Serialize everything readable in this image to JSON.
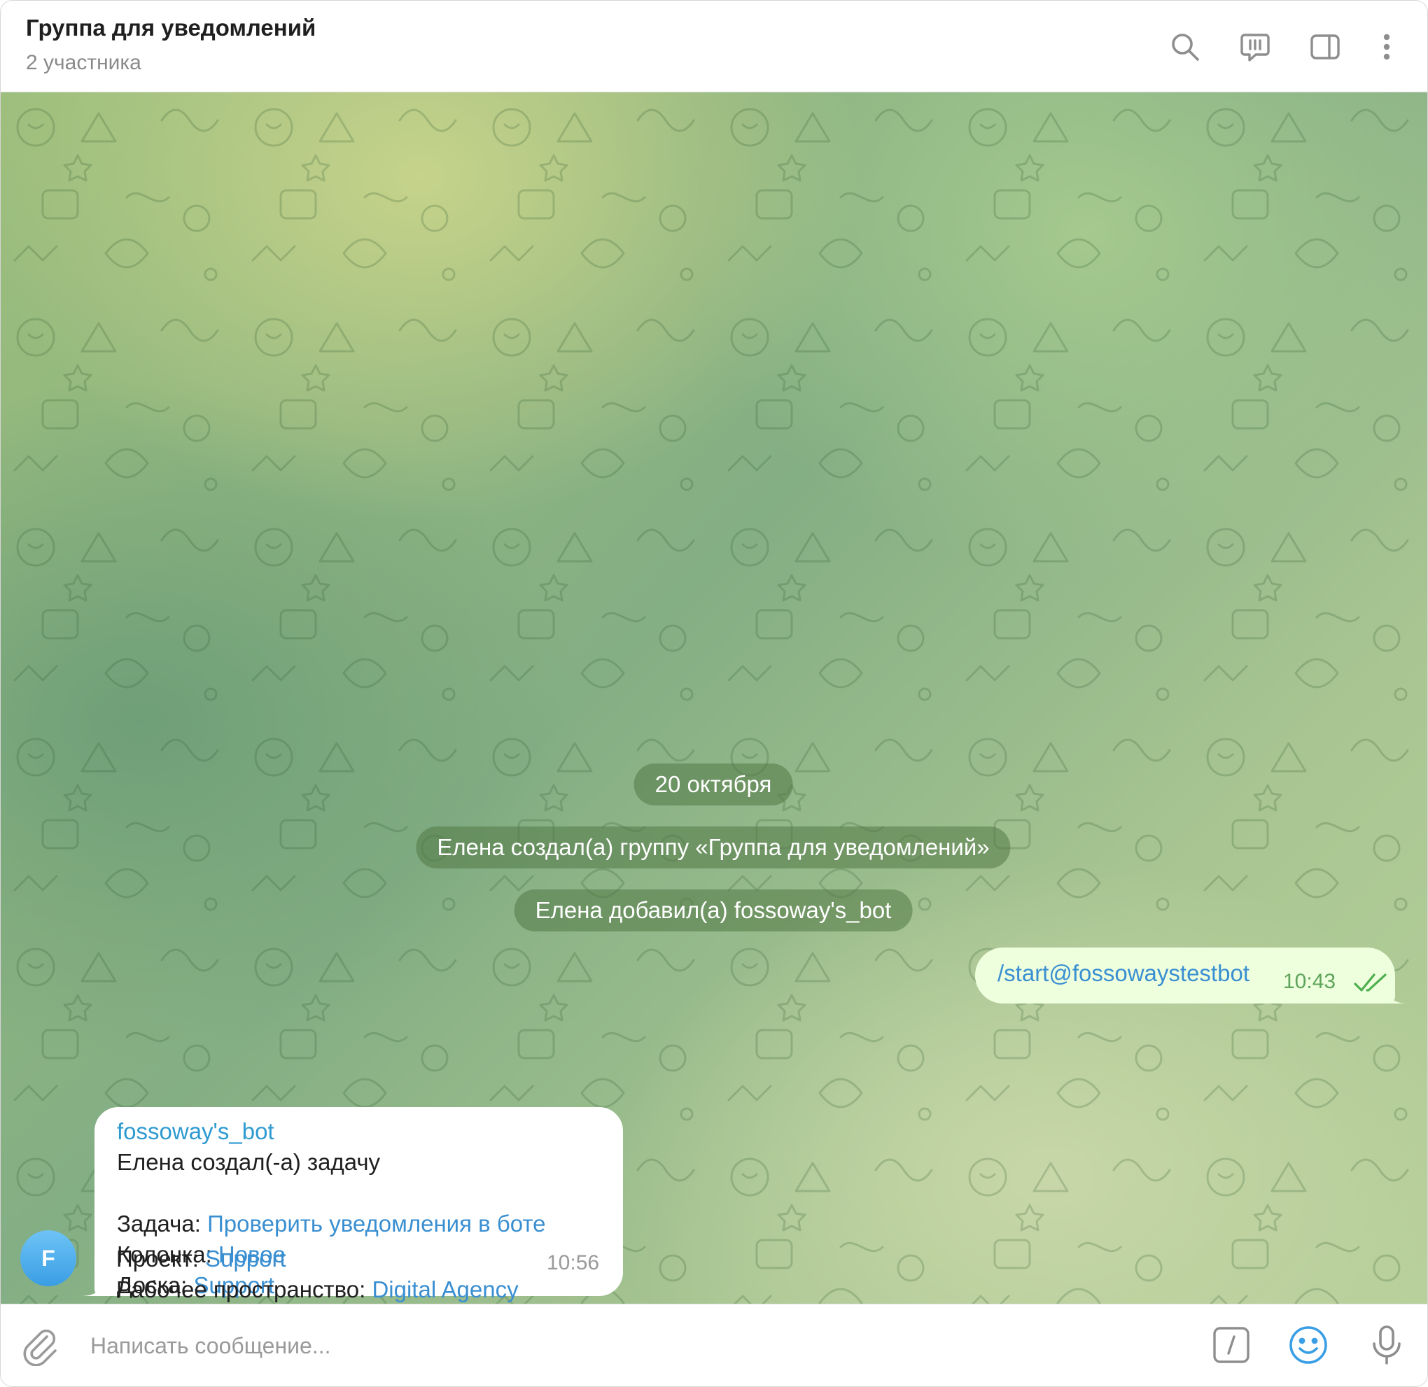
{
  "header": {
    "title": "Группа для уведомлений",
    "subtitle": "2 участника",
    "icons": [
      "search-icon",
      "topics-icon",
      "sidebar-toggle-icon",
      "more-vertical-icon"
    ]
  },
  "chat": {
    "date_label": "20 октября",
    "service_messages": [
      "Елена создал(а) группу «Группа для уведомлений»",
      "Елена добавил(а) fossoway's_bot"
    ],
    "outgoing": {
      "text": "/start@fossowaystestbot",
      "time": "10:43",
      "status_icon": "double-check-icon"
    },
    "incoming": {
      "avatar_letter": "F",
      "sender": "fossoway's_bot",
      "intro": "Елена создал(-а) задачу",
      "fields": [
        {
          "label": "Задача: ",
          "value": "Проверить уведомления в боте"
        },
        {
          "label": "Колонка: ",
          "value": "Новое"
        },
        {
          "label": "Доска: ",
          "value": "Support"
        },
        {
          "label": "Проект: ",
          "value": "Support"
        },
        {
          "label": "Рабочее пространство: ",
          "value": "Digital Agency"
        }
      ],
      "time": "10:56"
    }
  },
  "composer": {
    "placeholder": "Написать сообщение...",
    "icons": [
      "paperclip-icon",
      "bot-command-icon",
      "emoji-icon",
      "microphone-icon"
    ]
  },
  "colors": {
    "accent": "#3a8fd1",
    "outgoing_bubble": "#eeffde",
    "service_pill": "#527846"
  }
}
